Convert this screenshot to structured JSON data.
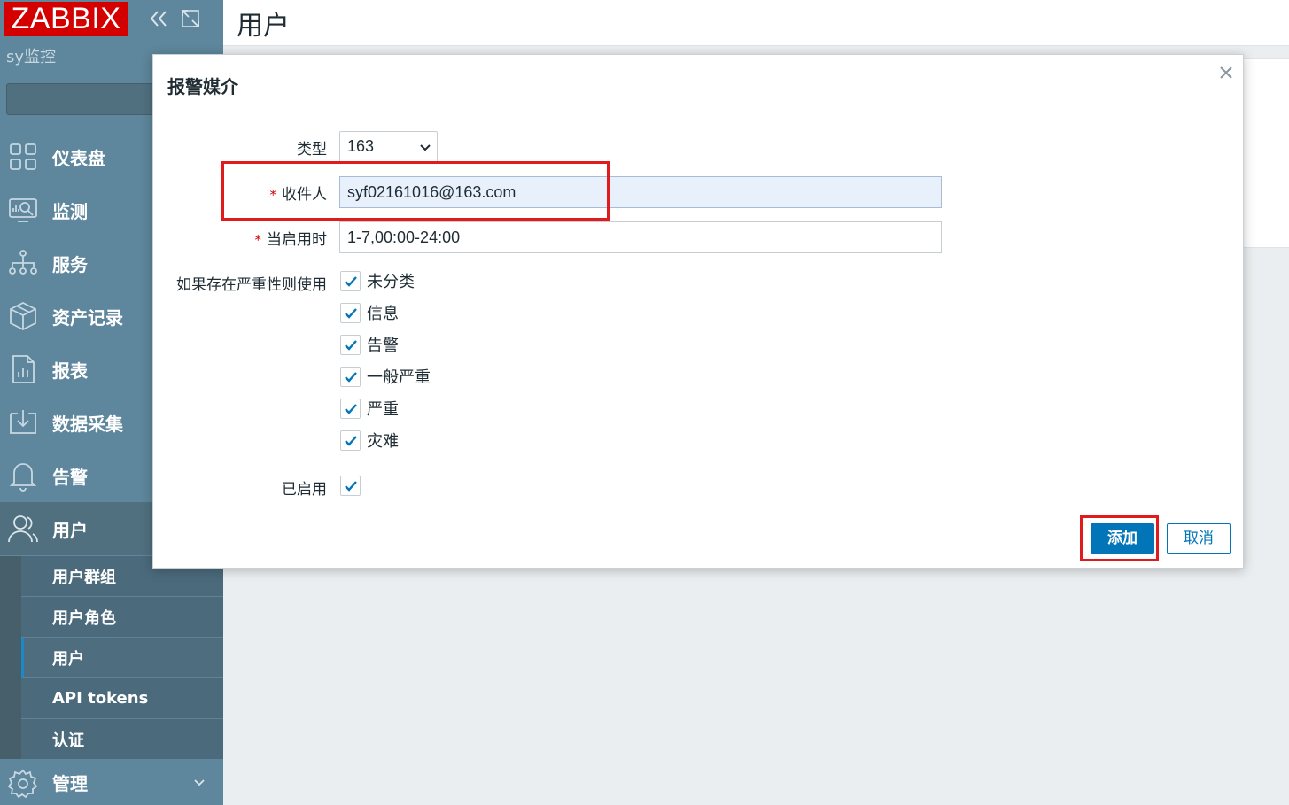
{
  "sidebar": {
    "logo": "ZABBIX",
    "server_name": "sy监控",
    "nav": [
      {
        "label": "仪表盘",
        "icon": "dashboard-icon"
      },
      {
        "label": "监测",
        "icon": "monitoring-icon"
      },
      {
        "label": "服务",
        "icon": "services-icon"
      },
      {
        "label": "资产记录",
        "icon": "inventory-icon"
      },
      {
        "label": "报表",
        "icon": "reports-icon"
      },
      {
        "label": "数据采集",
        "icon": "data-collection-icon"
      },
      {
        "label": "告警",
        "icon": "alerts-icon"
      },
      {
        "label": "用户",
        "icon": "users-icon"
      }
    ],
    "submenu": [
      {
        "label": "用户群组"
      },
      {
        "label": "用户角色"
      },
      {
        "label": "用户"
      },
      {
        "label": "API tokens"
      },
      {
        "label": "认证"
      }
    ],
    "manage": {
      "label": "管理",
      "icon": "gear-icon"
    }
  },
  "page": {
    "title": "用户"
  },
  "modal": {
    "title": "报警媒介",
    "type_label": "类型",
    "type_value": "163",
    "recipient_label": "收件人",
    "recipient_value": "syf02161016@163.com",
    "when_active_label": "当启用时",
    "when_active_value": "1-7,00:00-24:00",
    "severity_label": "如果存在严重性则使用",
    "severities": [
      {
        "label": "未分类",
        "checked": true
      },
      {
        "label": "信息",
        "checked": true
      },
      {
        "label": "告警",
        "checked": true
      },
      {
        "label": "一般严重",
        "checked": true
      },
      {
        "label": "严重",
        "checked": true
      },
      {
        "label": "灾难",
        "checked": true
      }
    ],
    "enabled_label": "已启用",
    "enabled_checked": true,
    "add_button": "添加",
    "cancel_button": "取消",
    "required_mark": "*"
  },
  "colors": {
    "sidebar": "#5e869c",
    "brand_red": "#d40000",
    "primary_blue": "#0275b8",
    "highlight_red": "#e01b1b"
  }
}
